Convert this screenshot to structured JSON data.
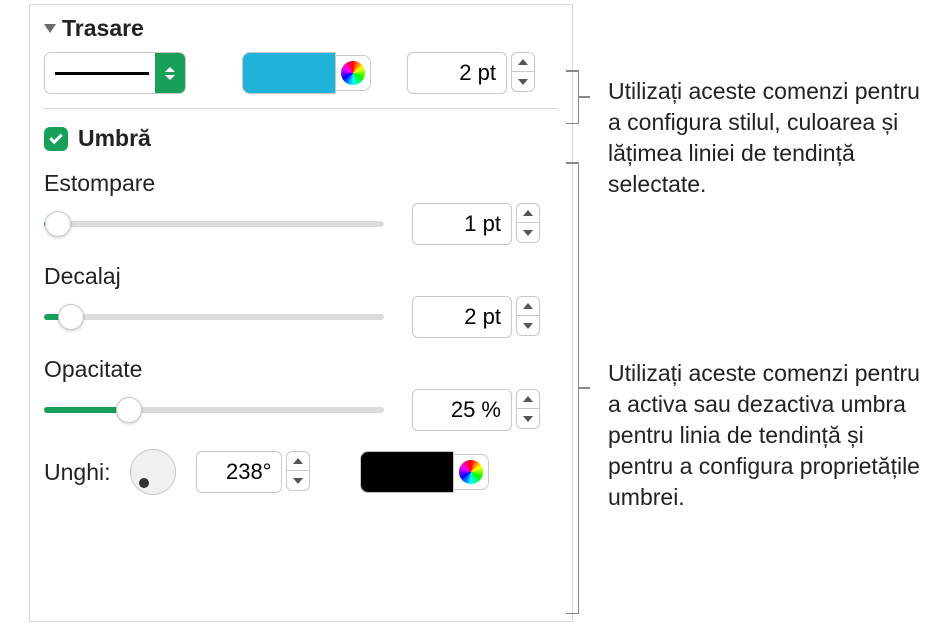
{
  "trasare": {
    "title": "Trasare",
    "stroke_color": "#1fb3da",
    "width_value": "2 pt"
  },
  "umbra": {
    "title": "Umbră",
    "checked": true,
    "estompare": {
      "label": "Estompare",
      "value": "1 pt",
      "slider_pct": 4
    },
    "decalaj": {
      "label": "Decalaj",
      "value": "2 pt",
      "slider_pct": 8
    },
    "opacitate": {
      "label": "Opacitate",
      "value": "25 %",
      "slider_pct": 25
    },
    "unghi": {
      "label": "Unghi:",
      "value": "238°"
    },
    "shadow_color": "#000000"
  },
  "callouts": {
    "c1": "Utilizați aceste comenzi pentru a configura stilul, culoarea și lățimea liniei de tendință selectate.",
    "c2": "Utilizați aceste comenzi pentru a activa sau dezactiva umbra pentru linia de tendință și pentru a configura proprietățile umbrei."
  }
}
